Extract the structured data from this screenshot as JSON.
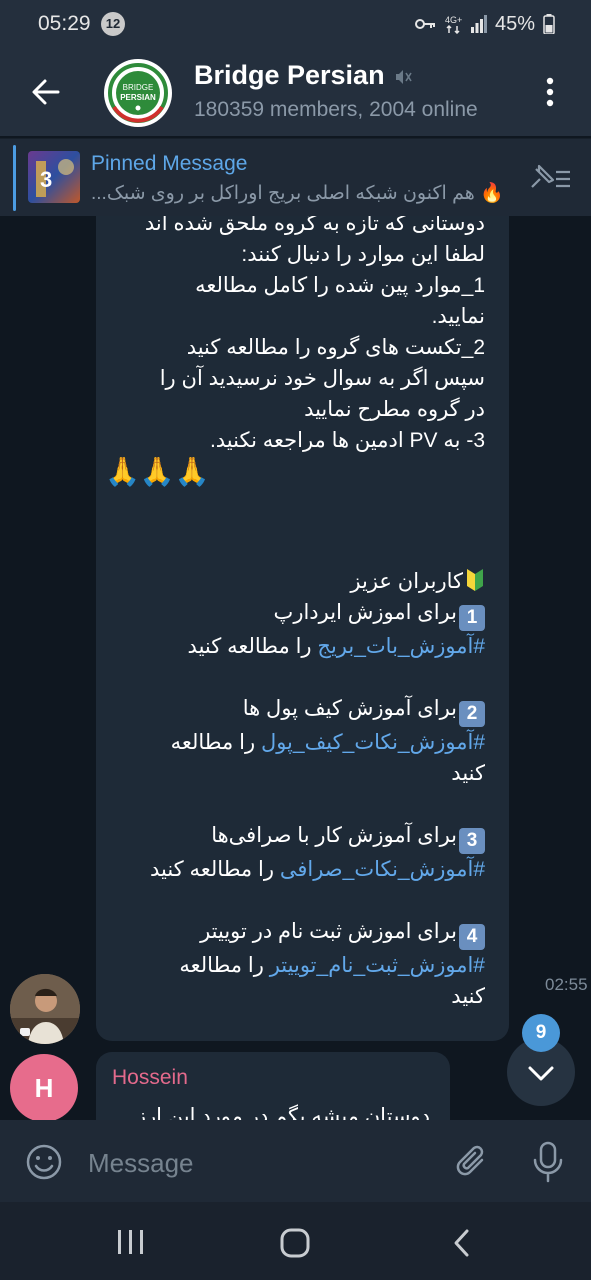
{
  "status": {
    "time": "05:29",
    "notif_count": "12",
    "battery": "45%"
  },
  "header": {
    "title": "Bridge Persian",
    "subtitle": "180359 members, 2004 online",
    "avatar_top": "BRIDGE",
    "avatar_bottom": "PERSIAN"
  },
  "pinned": {
    "title": "Pinned Message",
    "text": "🔥 هم اکنون شبکه اصلی بریج اوراکل بر روی شبک..."
  },
  "message1": {
    "lines_top": [
      "دوستانی که تازه به گروه ملحق شده اند",
      "لطفا این موارد را دنبال کنند:",
      "1_موارد پین شده را کامل مطالعه",
      "نمایید.",
      "2_تکست های گروه را مطالعه کنید",
      "سپس اگر به سوال خود نرسیدید آن را",
      "در گروه مطرح نمایید",
      "3- به PV ادمین ها مراجعه نکنید."
    ],
    "prayer": "🙏🙏🙏",
    "greeting": "کاربران عزیز",
    "items": [
      {
        "num": "1",
        "line1": "برای اموزش ایردارپ",
        "hashtag": "#آموزش_بات_بریج",
        "rest": "را مطالعه کنید",
        "tail": ""
      },
      {
        "num": "2",
        "line1": "برای آموزش کیف پول ها",
        "hashtag": "#آموزش_نکات_کیف_پول",
        "rest": "را مطالعه",
        "tail": "کنید"
      },
      {
        "num": "3",
        "line1": "برای آموزش کار با صرافی‌ها",
        "hashtag": "#آموزش_نکات_صرافی",
        "rest": "را مطالعه کنید",
        "tail": ""
      },
      {
        "num": "4",
        "line1": "برای اموزش ثبت نام در توییتر",
        "hashtag": "#اموزش_ثبت_نام_توییتر",
        "rest": "را مطالعه",
        "tail": "کنید"
      }
    ],
    "time": "02:55"
  },
  "message2": {
    "avatar_letter": "H",
    "sender": "Hossein",
    "preview": "دوستان میشه بگم در مورد این ارز"
  },
  "scroll": {
    "unread": "9"
  },
  "input": {
    "placeholder": "Message"
  },
  "colors": {
    "accent": "#5ea7e8",
    "sender": "#e46a8c",
    "bubble": "#1e2a37",
    "background": "#0f1720"
  }
}
